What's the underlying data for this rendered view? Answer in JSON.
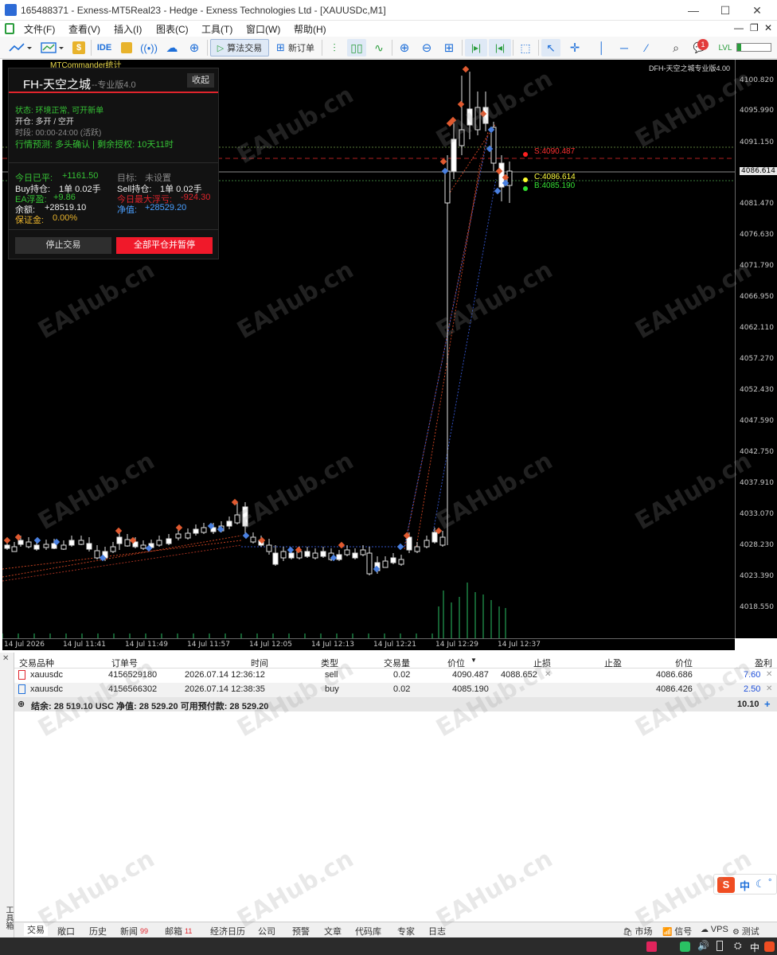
{
  "window": {
    "title": "165488371 - Exness-MT5Real23 - Hedge - Exness Technologies Ltd - [XAUUSDc,M1]",
    "min": "—",
    "max": "☐",
    "close": "✕"
  },
  "menu": [
    "文件(F)",
    "查看(V)",
    "插入(I)",
    "图表(C)",
    "工具(T)",
    "窗口(W)",
    "帮助(H)"
  ],
  "toolbar": {
    "ide": "IDE",
    "algo": "算法交易",
    "neworder": "新订单",
    "notif_count": "1"
  },
  "chart": {
    "top_label": "MTCommander统计",
    "top_right": "DFH-天空之城专业版4.00",
    "current_price": "4086.614",
    "prices": [
      "4100.820",
      "4095.990",
      "4091.150",
      "4086.614",
      "4081.470",
      "4076.630",
      "4071.790",
      "4066.950",
      "4062.110",
      "4057.270",
      "4052.430",
      "4047.590",
      "4042.750",
      "4037.910",
      "4033.070",
      "4028.230",
      "4023.390",
      "4018.550"
    ],
    "times": [
      "14 Jul 2026",
      "14 Jul 11:41",
      "14 Jul 11:49",
      "14 Jul 11:57",
      "14 Jul 12:05",
      "14 Jul 12:13",
      "14 Jul 12:21",
      "14 Jul 12:29",
      "14 Jul 12:37"
    ],
    "labels": {
      "s": "S:4090.487",
      "c": "C:4086.614",
      "b": "B:4085.190"
    }
  },
  "panel": {
    "title": "FH-天空之城",
    "subtitle": "--专业版4.0",
    "collapse": "收起",
    "status": "状态: 环境正常, 可开新单",
    "open": "开仓: 多开 / 空开",
    "session": "时段: 00:00-24:00 (活跃)",
    "forecast": "行情预测: 多头确认 | 剩余授权: 10天11时",
    "today_closed_label": "今日已平:",
    "today_closed": "+1161.50",
    "target_label": "目标:",
    "target": "未设置",
    "buy_label": "Buy持仓:",
    "buy": "1单 0.02手",
    "sell_label": "Sell持仓:",
    "sell": "1单 0.02手",
    "ea_float_label": "EA浮盈:",
    "ea_float": "+9.86",
    "max_float_label": "今日最大浮亏:",
    "max_float": "-924.30",
    "balance_label": "余额:",
    "balance": "+28519.10",
    "equity_label": "净值:",
    "equity": "+28529.20",
    "margin_label": "保证金:",
    "margin": "0.00%",
    "stop_btn": "停止交易",
    "close_btn": "全部平仓并暂停"
  },
  "table": {
    "headers": [
      "交易品种",
      "订单号",
      "时间",
      "类型",
      "交易量",
      "价位",
      "止损",
      "止盈",
      "价位",
      "盈利"
    ],
    "rows": [
      {
        "symbol": "xauusdc",
        "order": "4156529180",
        "time": "2026.07.14 12:36:12",
        "type": "sell",
        "volume": "0.02",
        "price": "4090.487",
        "sl": "4088.652",
        "tp": "",
        "cur": "4086.686",
        "profit": "7.60"
      },
      {
        "symbol": "xauusdc",
        "order": "4156566302",
        "time": "2026.07.14 12:38:35",
        "type": "buy",
        "volume": "0.02",
        "price": "4085.190",
        "sl": "",
        "tp": "",
        "cur": "4086.426",
        "profit": "2.50"
      }
    ],
    "summary": "结余: 28 519.10 USC  净值: 28 529.20  可用预付款: 28 529.20",
    "summary_total": "10.10"
  },
  "tabs": [
    "交易",
    "敞口",
    "历史",
    "新闻",
    "邮箱",
    "经济日历",
    "公司",
    "预警",
    "文章",
    "代码库",
    "专家",
    "日志"
  ],
  "tab_badges": {
    "news": "99",
    "mail": "11"
  },
  "tabs_right": [
    "市场",
    "信号",
    "VPS",
    "测试"
  ],
  "sidebar_label": "工具箱",
  "watermark": "EAHub.cn",
  "ime": {
    "lang": "中"
  }
}
